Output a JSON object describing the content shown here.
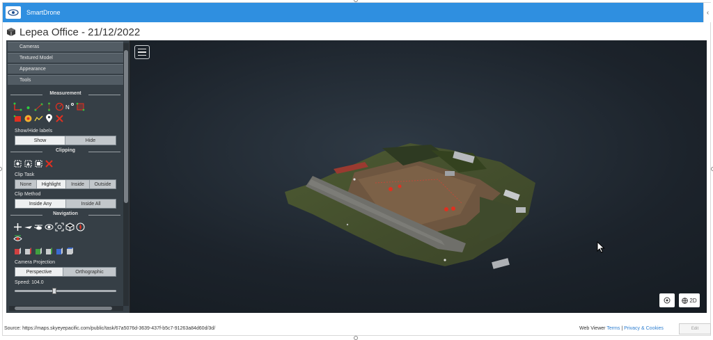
{
  "app": {
    "name": "SmartDrone",
    "title": "Lepea Office - 21/12/2022"
  },
  "sidebar": {
    "accordion": [
      "Cameras",
      "Textured Model",
      "Appearance",
      "Tools"
    ],
    "measurement": {
      "title": "Measurement",
      "labels_title": "Show/Hide labels",
      "labels_options": [
        "Show",
        "Hide"
      ]
    },
    "clipping": {
      "title": "Clipping",
      "clip_task_title": "Clip Task",
      "clip_task_options": [
        "None",
        "Highlight",
        "Inside",
        "Outside"
      ],
      "clip_method_title": "Clip Method",
      "clip_method_options": [
        "Inside Any",
        "Inside All"
      ]
    },
    "navigation": {
      "title": "Navigation",
      "projection_title": "Camera Projection",
      "projection_options": [
        "Perspective",
        "Orthographic"
      ],
      "speed_label": "Speed: 104.0",
      "speed_value": 104.0
    }
  },
  "viewer": {
    "toggle_2d_label": "2D"
  },
  "footer": {
    "source": "Source: https://maps.skyeyepacific.com/public/task/67a5076d-3639-437f-b5c7-91263a84d60d/3d/",
    "web_viewer": "Web Viewer",
    "terms": "Terms",
    "separator": "|",
    "privacy": "Privacy & Cookies",
    "edit": "Edit"
  },
  "colors": {
    "appbar": "#2f8fe0",
    "viewer_bg": "#1c232b",
    "sidebar_bg": "#363f46",
    "accent_red": "#e03020"
  }
}
